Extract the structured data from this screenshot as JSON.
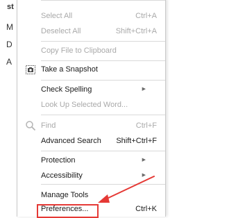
{
  "document": {
    "lines": [
      "st",
      "M",
      "D",
      "A"
    ]
  },
  "menu": {
    "select_all": {
      "label": "Select All",
      "shortcut": "Ctrl+A"
    },
    "deselect_all": {
      "label": "Deselect All",
      "shortcut": "Shift+Ctrl+A"
    },
    "copy_file": {
      "label": "Copy File to Clipboard"
    },
    "snapshot": {
      "label": "Take a Snapshot"
    },
    "check_spelling": {
      "label": "Check Spelling"
    },
    "look_up": {
      "label": "Look Up Selected Word..."
    },
    "find": {
      "label": "Find",
      "shortcut": "Ctrl+F"
    },
    "advanced_search": {
      "label": "Advanced Search",
      "shortcut": "Shift+Ctrl+F"
    },
    "protection": {
      "label": "Protection"
    },
    "accessibility": {
      "label": "Accessibility"
    },
    "manage_tools": {
      "label": "Manage Tools"
    },
    "preferences": {
      "label": "Preferences...",
      "shortcut": "Ctrl+K"
    }
  },
  "annotation": {
    "color": "#e53935"
  },
  "icons": {
    "snapshot": "camera-icon",
    "find": "search-icon",
    "submenu": "submenu-arrow-icon"
  }
}
